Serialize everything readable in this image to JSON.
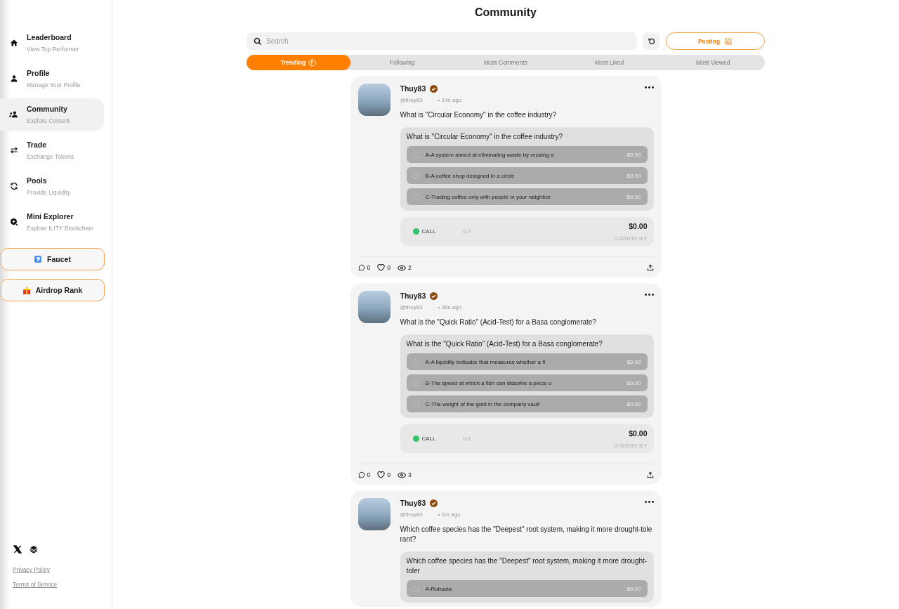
{
  "sidebar": {
    "items": [
      {
        "kind": "home",
        "title": "Leaderboard",
        "subtitle": "View Top Performer",
        "selected": false
      },
      {
        "kind": "person",
        "title": "Profile",
        "subtitle": "Manage Your Profile",
        "selected": false
      },
      {
        "kind": "people",
        "title": "Community",
        "subtitle": "Explore Content",
        "selected": true
      },
      {
        "kind": "swap",
        "title": "Trade",
        "subtitle": "Exchange Tokens",
        "selected": false
      },
      {
        "kind": "sync",
        "title": "Pools",
        "subtitle": "Provide Liquidity",
        "selected": false
      },
      {
        "kind": "explore",
        "title": "Mini Explorer",
        "subtitle": "Explore ILITY Blockchain",
        "selected": false
      }
    ],
    "buttons": [
      {
        "kind": "faucet",
        "label": "Faucet"
      },
      {
        "kind": "gift",
        "label": "Airdrop Rank"
      }
    ],
    "social": [
      {
        "kind": "x"
      },
      {
        "kind": "layers"
      }
    ],
    "links": [
      "Privacy Policy",
      "Terms of Service"
    ]
  },
  "page_title": "Community",
  "search": {
    "placeholder": "Search"
  },
  "post_button": "Posting",
  "tabs": [
    {
      "label": "Trending",
      "selected": true,
      "icon": true
    },
    {
      "label": "Following",
      "selected": false,
      "icon": false
    },
    {
      "label": "Most Comments",
      "selected": false,
      "icon": false
    },
    {
      "label": "Most Liked",
      "selected": false,
      "icon": false
    },
    {
      "label": "Most Viewed",
      "selected": false,
      "icon": false
    }
  ],
  "posts": [
    {
      "author": "Thuy83",
      "verified": true,
      "handle": "@thuy83",
      "time": "14s ago",
      "text": "What is \"Circular Economy\" in the coffee industry?",
      "quiz": {
        "question": "What is \"Circular Economy\" in the coffee industry?",
        "options": [
          {
            "label": "A-A system aimed at eliminating waste by reusing a",
            "amount": "$0.00",
            "selected": false
          },
          {
            "label": "B-A coffee shop designed in a circle",
            "amount": "$0.00",
            "selected": false
          },
          {
            "label": "C-Trading coffee only with people in your neighbor",
            "amount": "$0.00",
            "selected": false
          }
        ]
      },
      "call": {
        "label": "CALL",
        "token": "ILY",
        "price": "$0.00",
        "amount": "0.025781 ILY"
      },
      "comments": "0",
      "likes": "0",
      "views": "2"
    },
    {
      "author": "Thuy83",
      "verified": true,
      "handle": "@thuy83",
      "time": "36s ago",
      "text": "What is the \"Quick Ratio\" (Acid-Test) for a Basa conglomerate?",
      "quiz": {
        "question": "What is the \"Quick Ratio\" (Acid-Test) for a Basa conglomerate?",
        "options": [
          {
            "label": "A-A liquidity indicator that measures whether a fi",
            "amount": "$0.00",
            "selected": false
          },
          {
            "label": "B-The speed at which a fish can dissolve a piece o",
            "amount": "$0.00",
            "selected": false
          },
          {
            "label": "C-The weight of the gold in the company vault",
            "amount": "$0.00",
            "selected": false
          }
        ]
      },
      "call": {
        "label": "CALL",
        "token": "ILY",
        "price": "$0.00",
        "amount": "0.025781 ILY"
      },
      "comments": "0",
      "likes": "0",
      "views": "3"
    },
    {
      "author": "Thuy83",
      "verified": true,
      "handle": "@thuy83",
      "time": "1m ago",
      "text": "Which coffee species has the \"Deepest\" root system, making it more drought-tolerant?",
      "quiz": {
        "question": "Which coffee species has the \"Deepest\" root system, making it more drought-toler",
        "options": [
          {
            "label": "A-Robusta",
            "amount": "$0.00",
            "selected": false
          }
        ]
      }
    }
  ]
}
